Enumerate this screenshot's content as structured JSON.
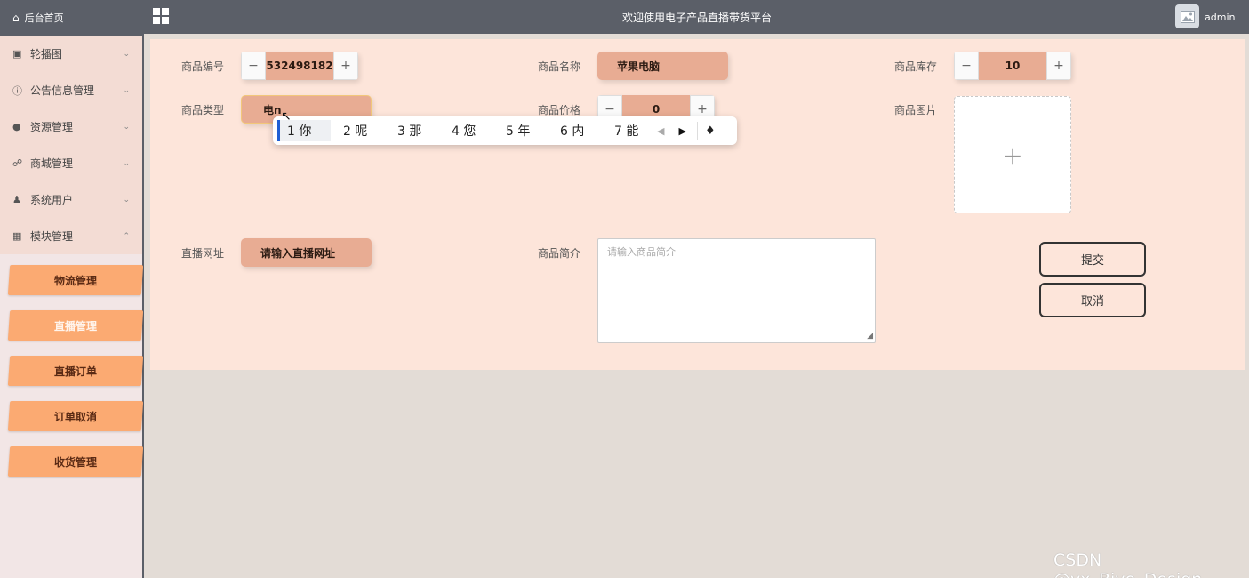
{
  "header": {
    "home_label": "后台首页",
    "title": "欢迎使用电子产品直播带货平台",
    "user": "admin"
  },
  "sidebar": {
    "items": [
      {
        "label": "轮播图",
        "icon": "image-icon"
      },
      {
        "label": "公告信息管理",
        "icon": "info-icon"
      },
      {
        "label": "资源管理",
        "icon": "bulb-icon"
      },
      {
        "label": "商城管理",
        "icon": "cart-icon"
      },
      {
        "label": "系统用户",
        "icon": "user-icon"
      },
      {
        "label": "模块管理",
        "icon": "grid-icon"
      }
    ],
    "submenu": [
      "物流管理",
      "直播管理",
      "直播订单",
      "订单取消",
      "收货管理"
    ],
    "active_submenu": "直播管理"
  },
  "form": {
    "product_id_label": "商品编号",
    "product_id_value": "532498182",
    "product_name_label": "商品名称",
    "product_name_value": "苹果电脑",
    "stock_label": "商品库存",
    "stock_value": "10",
    "type_label": "商品类型",
    "type_value": "电n",
    "price_label": "商品价格",
    "price_value": "0",
    "image_label": "商品图片",
    "live_url_label": "直播网址",
    "live_url_placeholder": "请输入直播网址",
    "intro_label": "商品简介",
    "intro_placeholder": "请输入商品简介",
    "submit_label": "提交",
    "cancel_label": "取消"
  },
  "ime": {
    "candidates": [
      "1 你",
      "2 呢",
      "3 那",
      "4 您",
      "5 年",
      "6 内",
      "7 能"
    ]
  },
  "watermark": "CSDN @vx_Biye_Design"
}
